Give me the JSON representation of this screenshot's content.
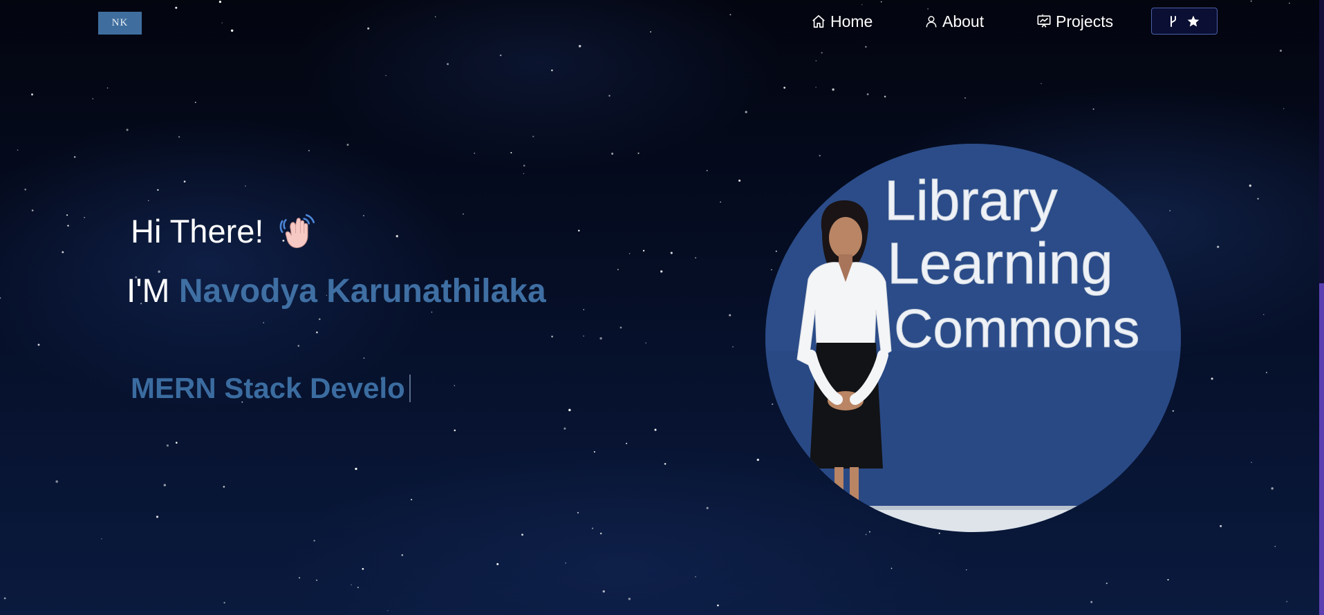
{
  "logo": {
    "text": "NK"
  },
  "nav": {
    "home_label": "Home",
    "about_label": "About",
    "projects_label": "Projects"
  },
  "hero": {
    "greeting": "Hi There!",
    "intro_prefix": "I'M",
    "name": "Navodya Karunathilaka",
    "typed_text": "MERN Stack Develo"
  },
  "photo": {
    "wall_sign": [
      "Library",
      "Learning",
      "Commons"
    ]
  },
  "colors": {
    "accent": "#3f6fa3",
    "background": "#050717",
    "logo_bg": "#3f6e9e",
    "scrollbar_thumb": "#5b3fb0"
  },
  "icons": {
    "home": "home-icon",
    "about": "user-icon",
    "projects": "presentation-icon",
    "github_fork": "fork-icon",
    "github_star": "star-icon",
    "wave": "waving-hand-icon"
  }
}
